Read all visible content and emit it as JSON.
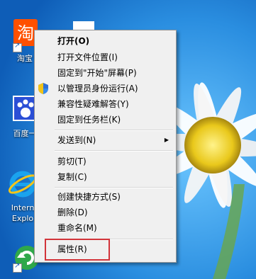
{
  "desktop": {
    "icons": [
      {
        "label": "淘宝",
        "name": "taobao"
      },
      {
        "label": "百度一",
        "name": "baidu"
      },
      {
        "label": "Intern",
        "label2": "Explo",
        "name": "internet-explorer"
      },
      {
        "label": "",
        "name": "refresh-app"
      }
    ]
  },
  "context_menu": {
    "items": [
      {
        "label": "打开(O)",
        "bold": true
      },
      {
        "label": "打开文件位置(I)"
      },
      {
        "label": "固定到\"开始\"屏幕(P)"
      },
      {
        "label": "以管理员身份运行(A)",
        "icon": "uac-shield-icon"
      },
      {
        "label": "兼容性疑难解答(Y)"
      },
      {
        "label": "固定到任务栏(K)"
      },
      {
        "label": "发送到(N)",
        "submenu": true
      },
      {
        "label": "剪切(T)"
      },
      {
        "label": "复制(C)"
      },
      {
        "label": "创建快捷方式(S)"
      },
      {
        "label": "删除(D)"
      },
      {
        "label": "重命名(M)"
      },
      {
        "label": "属性(R)"
      }
    ]
  },
  "colors": {
    "desktop_bg": "#1f7fd0",
    "highlight": "#d2343a",
    "menu_bg": "#f0f0f0"
  }
}
